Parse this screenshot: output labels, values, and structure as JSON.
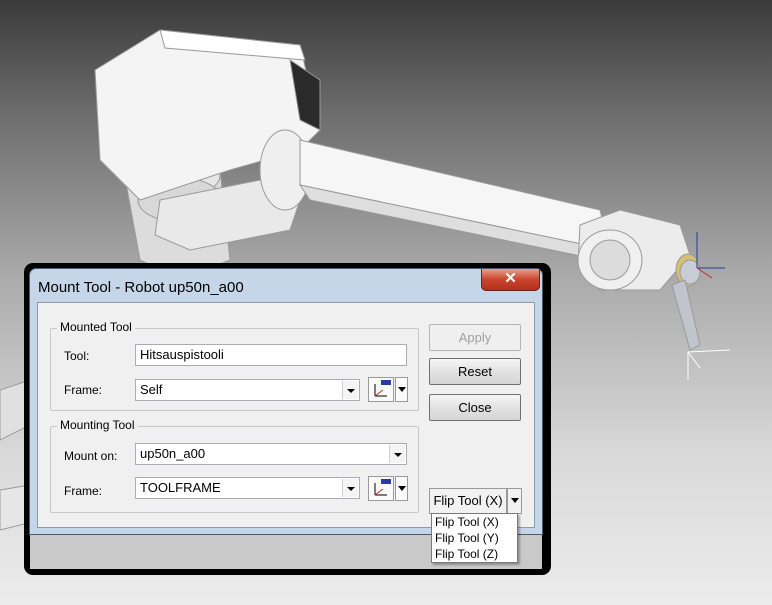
{
  "dialog": {
    "title": "Mount Tool - Robot up50n_a00",
    "close_label": "✕"
  },
  "mounted_tool": {
    "group_label": "Mounted Tool",
    "tool_label": "Tool:",
    "tool_value": "Hitsauspistooli",
    "frame_label": "Frame:",
    "frame_value": "Self"
  },
  "mounting_tool": {
    "group_label": "Mounting Tool",
    "mount_on_label": "Mount on:",
    "mount_on_value": "up50n_a00",
    "frame_label": "Frame:",
    "frame_value": "TOOLFRAME"
  },
  "buttons": {
    "apply": "Apply",
    "reset": "Reset",
    "close": "Close"
  },
  "flip": {
    "button_label": "Flip Tool (X)",
    "menu": [
      "Flip Tool (X)",
      "Flip Tool (Y)",
      "Flip Tool (Z)"
    ]
  },
  "colors": {
    "title_bar": "#c5d6e9",
    "close_button": "#c9452e",
    "client": "#f0f0f0"
  }
}
